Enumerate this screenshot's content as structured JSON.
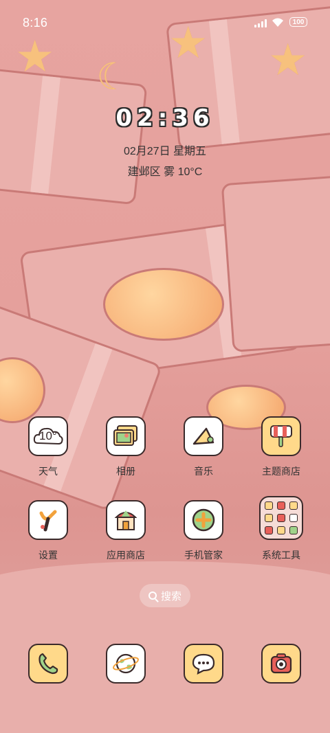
{
  "status_bar": {
    "time": "8:16",
    "battery": "100"
  },
  "clock_widget": {
    "time": "02:36",
    "date": "02月27日 星期五",
    "weather": "建邺区 雾 10°C"
  },
  "apps": [
    {
      "label": "天气",
      "icon": "weather-icon"
    },
    {
      "label": "相册",
      "icon": "gallery-icon"
    },
    {
      "label": "音乐",
      "icon": "music-icon"
    },
    {
      "label": "主题商店",
      "icon": "theme-store-icon"
    },
    {
      "label": "设置",
      "icon": "settings-icon"
    },
    {
      "label": "应用商店",
      "icon": "app-store-icon"
    },
    {
      "label": "手机管家",
      "icon": "phone-manager-icon"
    },
    {
      "label": "系统工具",
      "icon": "system-tools-folder-icon"
    }
  ],
  "weather_icon_text": "10°",
  "search": {
    "label": "搜索"
  },
  "dock": [
    {
      "icon": "phone-icon"
    },
    {
      "icon": "browser-icon"
    },
    {
      "icon": "messages-icon"
    },
    {
      "icon": "camera-icon"
    }
  ],
  "colors": {
    "wallpaper": "#e5a09c",
    "icon_yellow": "#ffd98a",
    "outline": "#3a2a2a"
  }
}
